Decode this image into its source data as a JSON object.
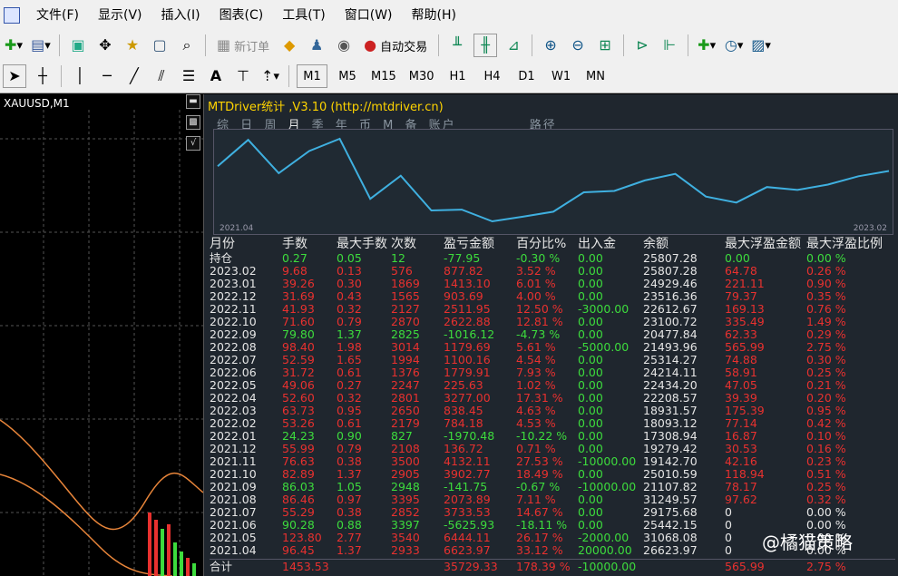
{
  "menu": [
    "文件(F)",
    "显示(V)",
    "插入(I)",
    "图表(C)",
    "工具(T)",
    "窗口(W)",
    "帮助(H)"
  ],
  "toolbar1": {
    "new_order": "新订单",
    "auto_trade": "自动交易"
  },
  "timeframes": [
    "M1",
    "M5",
    "M15",
    "M30",
    "H1",
    "H4",
    "D1",
    "W1",
    "MN"
  ],
  "chart": {
    "symbol": "XAUUSD,M1"
  },
  "panel": {
    "title": "MTDriver统计 ,V3.10 (http://mtdriver.cn)",
    "tabs": [
      "综",
      "日",
      "周",
      "月",
      "季",
      "年",
      "币",
      "M",
      "备",
      "账户",
      "路径"
    ],
    "equity_chart": {
      "x_start_label": "2021.04",
      "x_end_label": "2023.02",
      "values": [
        26623.97,
        31068.08,
        25442.15,
        29175.68,
        31249.57,
        21107.82,
        25010.59,
        19142.7,
        19279.42,
        17308.94,
        18093.12,
        18931.57,
        22208.57,
        22434.2,
        24214.11,
        25314.27,
        21493.96,
        20477.84,
        23100.72,
        22612.67,
        23516.36,
        24929.46,
        25807.28
      ]
    },
    "headers": [
      "月份",
      "手数",
      "最大手数",
      "次数",
      "盈亏金额",
      "百分比%",
      "出入金",
      "余额",
      "最大浮盈金额",
      "最大浮盈比例"
    ],
    "rows": [
      {
        "m": "持仓",
        "lots": "0.27",
        "maxlots": "0.05",
        "cnt": "12",
        "pl": "-77.95",
        "pct": "-0.30 %",
        "io": "0.00",
        "bal": "25807.28",
        "mfe": "0.00",
        "mfep": "0.00 %",
        "pos": false
      },
      {
        "m": "2023.02",
        "lots": "9.68",
        "maxlots": "0.13",
        "cnt": "576",
        "pl": "877.82",
        "pct": "3.52 %",
        "io": "0.00",
        "bal": "25807.28",
        "mfe": "64.78",
        "mfep": "0.26 %",
        "pos": true
      },
      {
        "m": "2023.01",
        "lots": "39.26",
        "maxlots": "0.30",
        "cnt": "1869",
        "pl": "1413.10",
        "pct": "6.01 %",
        "io": "0.00",
        "bal": "24929.46",
        "mfe": "221.11",
        "mfep": "0.90 %",
        "pos": true
      },
      {
        "m": "2022.12",
        "lots": "31.69",
        "maxlots": "0.43",
        "cnt": "1565",
        "pl": "903.69",
        "pct": "4.00 %",
        "io": "0.00",
        "bal": "23516.36",
        "mfe": "79.37",
        "mfep": "0.35 %",
        "pos": true
      },
      {
        "m": "2022.11",
        "lots": "41.93",
        "maxlots": "0.32",
        "cnt": "2127",
        "pl": "2511.95",
        "pct": "12.50 %",
        "io": "-3000.00",
        "bal": "22612.67",
        "mfe": "169.13",
        "mfep": "0.76 %",
        "pos": true
      },
      {
        "m": "2022.10",
        "lots": "71.60",
        "maxlots": "0.79",
        "cnt": "2870",
        "pl": "2622.88",
        "pct": "12.81 %",
        "io": "0.00",
        "bal": "23100.72",
        "mfe": "335.49",
        "mfep": "1.49 %",
        "pos": true
      },
      {
        "m": "2022.09",
        "lots": "79.80",
        "maxlots": "1.37",
        "cnt": "2825",
        "pl": "-1016.12",
        "pct": "-4.73 %",
        "io": "0.00",
        "bal": "20477.84",
        "mfe": "62.33",
        "mfep": "0.29 %",
        "pos": false
      },
      {
        "m": "2022.08",
        "lots": "98.40",
        "maxlots": "1.98",
        "cnt": "3014",
        "pl": "1179.69",
        "pct": "5.61 %",
        "io": "-5000.00",
        "bal": "21493.96",
        "mfe": "565.99",
        "mfep": "2.75 %",
        "pos": true
      },
      {
        "m": "2022.07",
        "lots": "52.59",
        "maxlots": "1.65",
        "cnt": "1994",
        "pl": "1100.16",
        "pct": "4.54 %",
        "io": "0.00",
        "bal": "25314.27",
        "mfe": "74.88",
        "mfep": "0.30 %",
        "pos": true
      },
      {
        "m": "2022.06",
        "lots": "31.72",
        "maxlots": "0.61",
        "cnt": "1376",
        "pl": "1779.91",
        "pct": "7.93 %",
        "io": "0.00",
        "bal": "24214.11",
        "mfe": "58.91",
        "mfep": "0.25 %",
        "pos": true
      },
      {
        "m": "2022.05",
        "lots": "49.06",
        "maxlots": "0.27",
        "cnt": "2247",
        "pl": "225.63",
        "pct": "1.02 %",
        "io": "0.00",
        "bal": "22434.20",
        "mfe": "47.05",
        "mfep": "0.21 %",
        "pos": true
      },
      {
        "m": "2022.04",
        "lots": "52.60",
        "maxlots": "0.32",
        "cnt": "2801",
        "pl": "3277.00",
        "pct": "17.31 %",
        "io": "0.00",
        "bal": "22208.57",
        "mfe": "39.39",
        "mfep": "0.20 %",
        "pos": true
      },
      {
        "m": "2022.03",
        "lots": "63.73",
        "maxlots": "0.95",
        "cnt": "2650",
        "pl": "838.45",
        "pct": "4.63 %",
        "io": "0.00",
        "bal": "18931.57",
        "mfe": "175.39",
        "mfep": "0.95 %",
        "pos": true
      },
      {
        "m": "2022.02",
        "lots": "53.26",
        "maxlots": "0.61",
        "cnt": "2179",
        "pl": "784.18",
        "pct": "4.53 %",
        "io": "0.00",
        "bal": "18093.12",
        "mfe": "77.14",
        "mfep": "0.42 %",
        "pos": true
      },
      {
        "m": "2022.01",
        "lots": "24.23",
        "maxlots": "0.90",
        "cnt": "827",
        "pl": "-1970.48",
        "pct": "-10.22 %",
        "io": "0.00",
        "bal": "17308.94",
        "mfe": "16.87",
        "mfep": "0.10 %",
        "pos": false
      },
      {
        "m": "2021.12",
        "lots": "55.99",
        "maxlots": "0.79",
        "cnt": "2108",
        "pl": "136.72",
        "pct": "0.71 %",
        "io": "0.00",
        "bal": "19279.42",
        "mfe": "30.53",
        "mfep": "0.16 %",
        "pos": true
      },
      {
        "m": "2021.11",
        "lots": "76.63",
        "maxlots": "0.38",
        "cnt": "3500",
        "pl": "4132.11",
        "pct": "27.53 %",
        "io": "-10000.00",
        "bal": "19142.70",
        "mfe": "42.16",
        "mfep": "0.23 %",
        "pos": true
      },
      {
        "m": "2021.10",
        "lots": "82.89",
        "maxlots": "1.37",
        "cnt": "2905",
        "pl": "3902.77",
        "pct": "18.49 %",
        "io": "0.00",
        "bal": "25010.59",
        "mfe": "118.94",
        "mfep": "0.51 %",
        "pos": true
      },
      {
        "m": "2021.09",
        "lots": "86.03",
        "maxlots": "1.05",
        "cnt": "2948",
        "pl": "-141.75",
        "pct": "-0.67 %",
        "io": "-10000.00",
        "bal": "21107.82",
        "mfe": "78.17",
        "mfep": "0.25 %",
        "pos": false
      },
      {
        "m": "2021.08",
        "lots": "86.46",
        "maxlots": "0.97",
        "cnt": "3395",
        "pl": "2073.89",
        "pct": "7.11 %",
        "io": "0.00",
        "bal": "31249.57",
        "mfe": "97.62",
        "mfep": "0.32 %",
        "pos": true
      },
      {
        "m": "2021.07",
        "lots": "55.29",
        "maxlots": "0.38",
        "cnt": "2852",
        "pl": "3733.53",
        "pct": "14.67 %",
        "io": "0.00",
        "bal": "29175.68",
        "mfe": "0",
        "mfep": "0.00 %",
        "pos": true
      },
      {
        "m": "2021.06",
        "lots": "90.28",
        "maxlots": "0.88",
        "cnt": "3397",
        "pl": "-5625.93",
        "pct": "-18.11 %",
        "io": "0.00",
        "bal": "25442.15",
        "mfe": "0",
        "mfep": "0.00 %",
        "pos": false
      },
      {
        "m": "2021.05",
        "lots": "123.80",
        "maxlots": "2.77",
        "cnt": "3540",
        "pl": "6444.11",
        "pct": "26.17 %",
        "io": "-2000.00",
        "bal": "31068.08",
        "mfe": "0",
        "mfep": "0.00 %",
        "pos": true
      },
      {
        "m": "2021.04",
        "lots": "96.45",
        "maxlots": "1.37",
        "cnt": "2933",
        "pl": "6623.97",
        "pct": "33.12 %",
        "io": "20000.00",
        "bal": "26623.97",
        "mfe": "0",
        "mfep": "0.00 %",
        "pos": true
      }
    ],
    "total": {
      "m": "合计",
      "lots": "1453.53",
      "pl": "35729.33",
      "pct": "178.39 %",
      "io": "-10000.00",
      "mfe": "565.99",
      "mfep": "2.75 %"
    }
  },
  "watermark": "@橘猫策略"
}
